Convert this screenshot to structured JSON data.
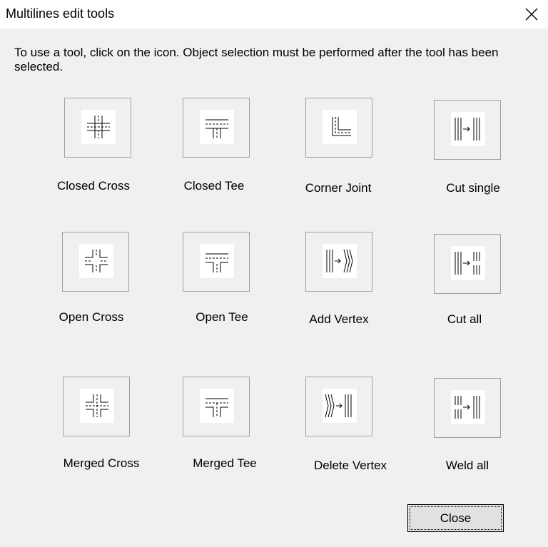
{
  "window": {
    "title": "Multilines edit tools",
    "close_icon": "close-icon"
  },
  "instructions": "To use a tool, click on the icon. Object selection must be performed after the tool has been selected.",
  "tools": [
    {
      "label": "Closed Cross",
      "icon": "closed-cross-icon"
    },
    {
      "label": "Closed Tee",
      "icon": "closed-tee-icon"
    },
    {
      "label": "Corner Joint",
      "icon": "corner-joint-icon"
    },
    {
      "label": "Cut single",
      "icon": "cut-single-icon"
    },
    {
      "label": "Open Cross",
      "icon": "open-cross-icon"
    },
    {
      "label": "Open Tee",
      "icon": "open-tee-icon"
    },
    {
      "label": "Add Vertex",
      "icon": "add-vertex-icon"
    },
    {
      "label": "Cut all",
      "icon": "cut-all-icon"
    },
    {
      "label": "Merged Cross",
      "icon": "merged-cross-icon"
    },
    {
      "label": "Merged Tee",
      "icon": "merged-tee-icon"
    },
    {
      "label": "Delete Vertex",
      "icon": "delete-vertex-icon"
    },
    {
      "label": "Weld all",
      "icon": "weld-all-icon"
    }
  ],
  "buttons": {
    "close_label": "Close"
  }
}
